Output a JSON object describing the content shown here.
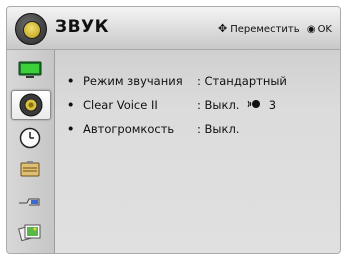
{
  "header": {
    "title": "ЗВУК",
    "hint_move": "Переместить",
    "hint_ok": "OK",
    "header_icon": "speaker-icon"
  },
  "sidebar": {
    "items": [
      {
        "name": "picture",
        "icon": "tv-screen-icon",
        "selected": false
      },
      {
        "name": "sound",
        "icon": "speaker-icon",
        "selected": true
      },
      {
        "name": "time",
        "icon": "clock-icon",
        "selected": false
      },
      {
        "name": "options",
        "icon": "toolbox-icon",
        "selected": false
      },
      {
        "name": "input",
        "icon": "input-plug-icon",
        "selected": false
      },
      {
        "name": "media",
        "icon": "photo-media-icon",
        "selected": false
      }
    ]
  },
  "menu": {
    "rows": [
      {
        "bullet": "•",
        "label": "Режим звучания",
        "value": ": Стандартный"
      },
      {
        "bullet": "•",
        "label": "Clear Voice II",
        "value": ": Выкл.",
        "level": "3",
        "level_icon": "voice-icon"
      },
      {
        "bullet": "•",
        "label": "Автогромкость",
        "value": ": Выкл."
      }
    ]
  }
}
